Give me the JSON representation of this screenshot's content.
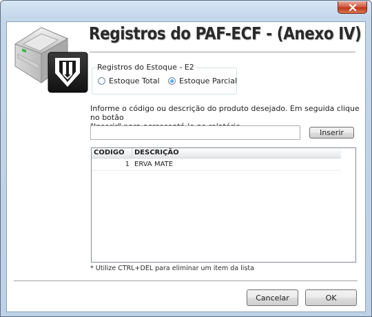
{
  "window": {
    "close_icon": "close-x-icon"
  },
  "header": {
    "title": "Registros do PAF-ECF - (Anexo IV)",
    "logo_icon": "printer-pen-logo"
  },
  "stock_group": {
    "legend": "Registros do Estoque - E2",
    "options": [
      {
        "label": "Estoque Total",
        "selected": false
      },
      {
        "label": "Estoque Parcial",
        "selected": true
      }
    ]
  },
  "instructions": {
    "line1": "Informe o código ou descrição do produto desejado. Em seguida clique no botão",
    "line2": "\"Inserir\" para acrescentá-lo no relatório."
  },
  "search": {
    "value": "",
    "placeholder": ""
  },
  "buttons": {
    "insert": "Inserir",
    "cancel": "Cancelar",
    "ok": "OK"
  },
  "grid": {
    "columns": [
      "CODIGO",
      "DESCRIÇÃO"
    ],
    "rows": [
      {
        "codigo": "1",
        "descricao": "ERVA MATE"
      }
    ]
  },
  "footnote": "* Utilize CTRL+DEL para eliminar um item da lista",
  "colors": {
    "frame": "#c3d6ea",
    "close_button": "#c0371b",
    "radio_selected": "#1c6fbd"
  }
}
